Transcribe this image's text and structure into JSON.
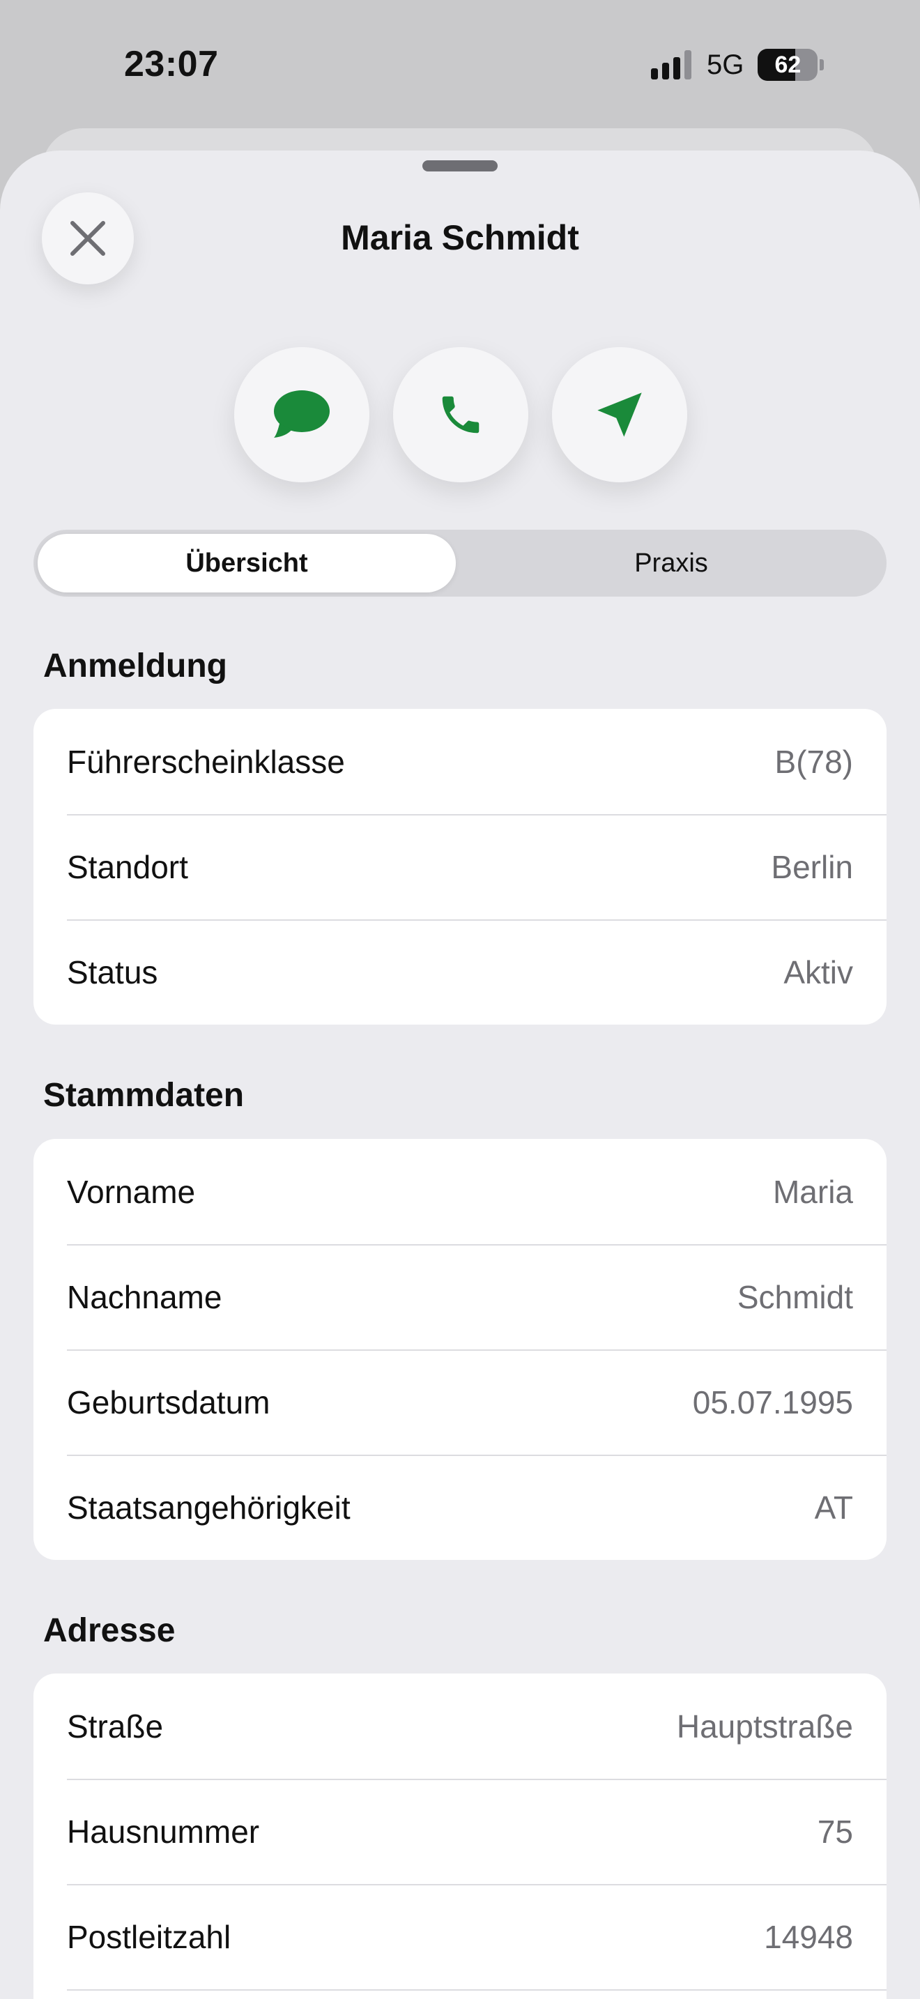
{
  "status_bar": {
    "time": "23:07",
    "network": "5G",
    "battery_percent": 62,
    "battery_label": "62"
  },
  "sheet": {
    "title": "Maria Schmidt",
    "actions": {
      "message_icon": "message-bubble-icon",
      "call_icon": "phone-icon",
      "send_icon": "paper-plane-icon",
      "accent_color": "#1a8a3a"
    }
  },
  "tabs": [
    {
      "label": "Übersicht",
      "selected": true
    },
    {
      "label": "Praxis",
      "selected": false
    }
  ],
  "sections": {
    "anmeldung": {
      "title": "Anmeldung",
      "rows": [
        {
          "label": "Führerscheinklasse",
          "value": "B(78)"
        },
        {
          "label": "Standort",
          "value": "Berlin"
        },
        {
          "label": "Status",
          "value": "Aktiv"
        }
      ]
    },
    "stammdaten": {
      "title": "Stammdaten",
      "rows": [
        {
          "label": "Vorname",
          "value": "Maria"
        },
        {
          "label": "Nachname",
          "value": "Schmidt"
        },
        {
          "label": "Geburtsdatum",
          "value": "05.07.1995"
        },
        {
          "label": "Staatsangehörigkeit",
          "value": "AT"
        }
      ]
    },
    "adresse": {
      "title": "Adresse",
      "rows": [
        {
          "label": "Straße",
          "value": "Hauptstraße"
        },
        {
          "label": "Hausnummer",
          "value": "75"
        },
        {
          "label": "Postleitzahl",
          "value": "14948"
        }
      ]
    }
  }
}
